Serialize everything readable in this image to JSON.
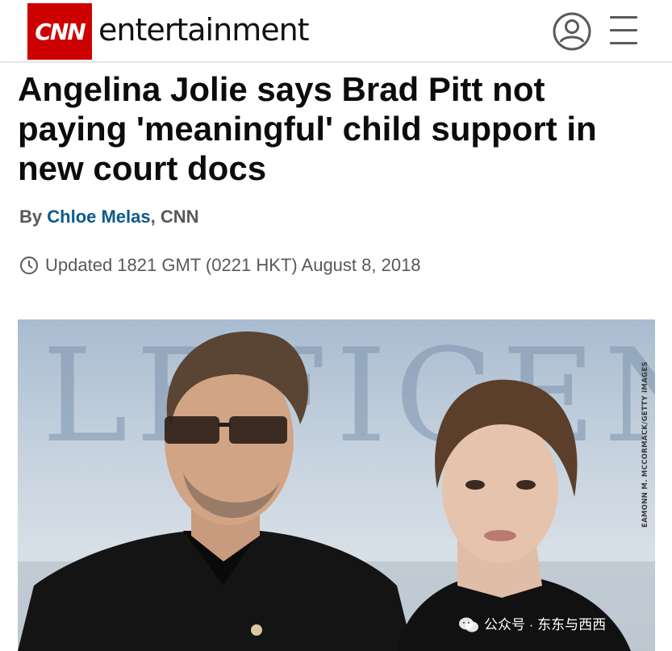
{
  "header": {
    "logo": "CNN",
    "section": "entertainment",
    "account_icon": "user-circle-icon",
    "menu_icon": "hamburger-menu-icon"
  },
  "article": {
    "headline": "Angelina Jolie says Brad Pitt not paying 'meaningful' child support in new court docs",
    "byline_prefix": "By ",
    "author": "Chloe Melas",
    "byline_suffix": ", CNN",
    "timestamp": "Updated 1821 GMT (0221 HKT) August 8, 2018",
    "clock_icon": "clock-icon"
  },
  "photo": {
    "credit": "EAMONN M. MCCORMACK/GETTY IMAGES",
    "backdrop_text": "LEFICENT"
  },
  "watermark": {
    "text": "公众号 · 东东与西西",
    "icon": "wechat-icon"
  },
  "colors": {
    "cnn_red": "#cc0000",
    "author_link": "#0c5a8a",
    "meta_gray": "#595959"
  }
}
